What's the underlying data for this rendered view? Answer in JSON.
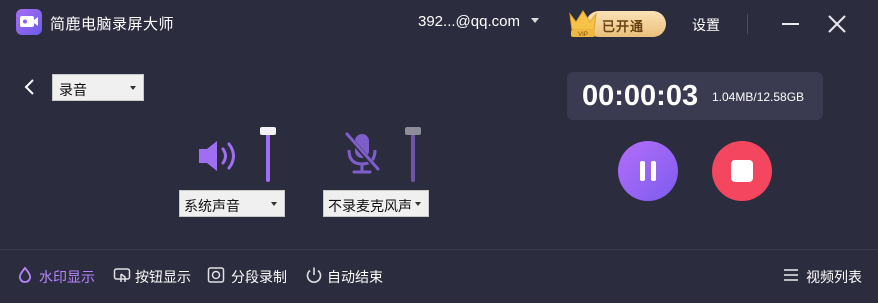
{
  "app": {
    "title": "简鹿电脑录屏大师"
  },
  "account": {
    "email": "392...@qq.com"
  },
  "vip": {
    "label": "已开通"
  },
  "settings": {
    "label": "设置"
  },
  "recorder": {
    "mode": "录音"
  },
  "audio": {
    "system": {
      "dropdown_value": "系统声音",
      "volume": 1.0
    },
    "microphone": {
      "dropdown_value": "不录麦克风声",
      "volume": 1.0,
      "muted": true
    }
  },
  "timer": {
    "elapsed": "00:00:03",
    "size": "1.04MB/12.58GB"
  },
  "bottom": {
    "watermark": "水印显示",
    "buttons": "按钮显示",
    "segment": "分段录制",
    "autoend": "自动结束",
    "videolist": "视频列表"
  },
  "colors": {
    "accent": "#a06ef2",
    "stop": "#f4475f",
    "background": "#2c2c3f"
  }
}
